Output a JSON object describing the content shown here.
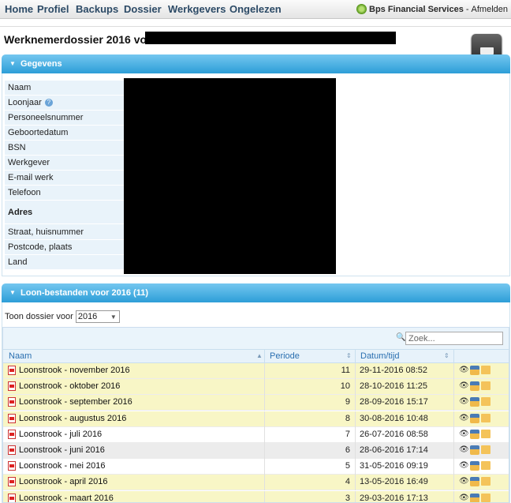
{
  "nav": {
    "items": [
      "Home",
      "Profiel",
      "Backups",
      "Dossier",
      "Werkgevers",
      "Ongelezen"
    ],
    "company": "Bps Financial Services",
    "separator": "-",
    "logout": "Afmelden"
  },
  "page": {
    "title": "Werknemerdossier 2016 voor"
  },
  "gegevens": {
    "header": "Gegevens",
    "fields": [
      "Naam",
      "Loonjaar",
      "Personeelsnummer",
      "Geboortedatum",
      "BSN",
      "Werkgever",
      "E-mail werk",
      "Telefoon",
      "Adres",
      "Straat, huisnummer",
      "Postcode, plaats",
      "Land"
    ]
  },
  "loon": {
    "header": "Loon-bestanden voor 2016 (11)",
    "toon_label": "Toon dossier voor",
    "year_selected": "2016",
    "search_placeholder": "Zoek...",
    "columns": [
      "Naam",
      "Periode",
      "Datum/tijd"
    ],
    "rows": [
      {
        "name": "Loonstrook - november 2016",
        "periode": "11",
        "datum": "29-11-2016 08:52"
      },
      {
        "name": "Loonstrook - oktober 2016",
        "periode": "10",
        "datum": "28-10-2016 11:25"
      },
      {
        "name": "Loonstrook - september 2016",
        "periode": "9",
        "datum": "28-09-2016 15:17"
      },
      {
        "name": "Loonstrook - augustus 2016",
        "periode": "8",
        "datum": "30-08-2016 10:48"
      },
      {
        "name": "Loonstrook - juli 2016",
        "periode": "7",
        "datum": "26-07-2016 08:58"
      },
      {
        "name": "Loonstrook - juni 2016",
        "periode": "6",
        "datum": "28-06-2016 17:14"
      },
      {
        "name": "Loonstrook - mei 2016",
        "periode": "5",
        "datum": "31-05-2016 09:19"
      },
      {
        "name": "Loonstrook - april 2016",
        "periode": "4",
        "datum": "13-05-2016 16:49"
      },
      {
        "name": "Loonstrook - maart 2016",
        "periode": "3",
        "datum": "29-03-2016 17:13"
      }
    ]
  }
}
